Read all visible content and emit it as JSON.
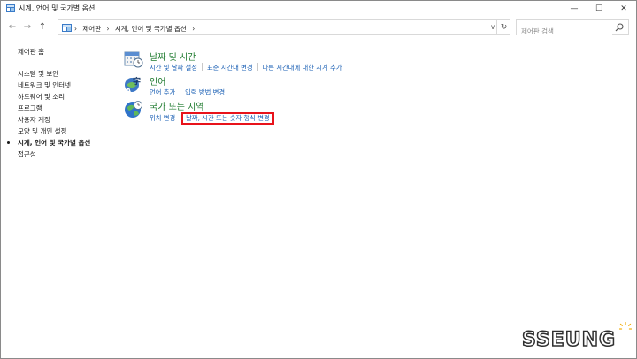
{
  "window": {
    "title": "시계, 언어 및 국가별 옵션",
    "controls": {
      "minimize": "—",
      "maximize": "☐",
      "close": "✕"
    }
  },
  "address_bar": {
    "back_icon": "←",
    "forward_icon": "→",
    "up_icon": "↑",
    "breadcrumbs": [
      "›",
      "제어판",
      "›",
      "시계, 언어 및 국가별 옵션",
      "›"
    ],
    "dropdown_icon": "∨",
    "refresh_icon": "↻",
    "search_placeholder": "제어판 검색"
  },
  "sidebar": {
    "home": "제어판 홈",
    "items": [
      {
        "label": "시스템 및 보안"
      },
      {
        "label": "네트워크 및 인터넷"
      },
      {
        "label": "하드웨어 및 소리"
      },
      {
        "label": "프로그램"
      },
      {
        "label": "사용자 계정"
      },
      {
        "label": "모양 및 개인 설정"
      },
      {
        "label": "시계, 언어 및 국가별 옵션",
        "active": true
      },
      {
        "label": "접근성"
      }
    ]
  },
  "categories": [
    {
      "title": "날짜 및 시간",
      "icon": "calendar-clock-icon",
      "links": [
        "시간 및 날짜 설정",
        "표준 시간대 변경",
        "다른 시간대에 대한 시계 추가"
      ]
    },
    {
      "title": "언어",
      "icon": "language-icon",
      "links": [
        "언어 추가",
        "입력 방법 변경"
      ]
    },
    {
      "title": "국가 또는 지역",
      "icon": "globe-clock-icon",
      "links": [
        "위치 변경",
        "날짜, 시간 또는 숫자 형식 변경"
      ]
    }
  ],
  "watermark": {
    "text": "SSEUNG"
  },
  "colors": {
    "category_title": "#1e7a2e",
    "link": "#1a5fb4",
    "highlight_box": "#e8131b"
  }
}
